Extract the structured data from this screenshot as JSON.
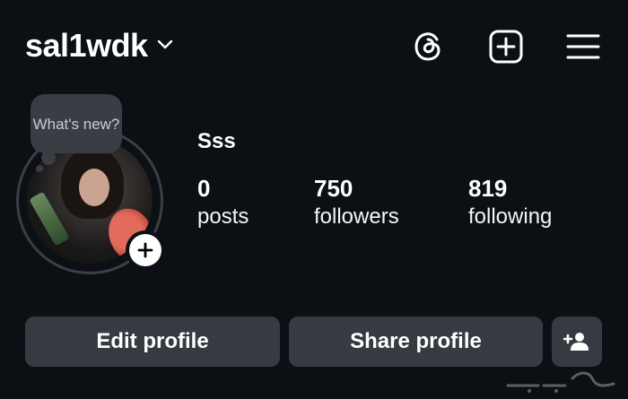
{
  "header": {
    "username": "sal1wdk",
    "icons": {
      "switch_account": "chevron-down-icon",
      "threads": "threads-icon",
      "create": "plus-square-icon",
      "menu": "hamburger-menu-icon"
    }
  },
  "profile": {
    "note_text": "What's new?",
    "display_name": "Sss",
    "stats": [
      {
        "value": "0",
        "label": "posts"
      },
      {
        "value": "750",
        "label": "followers"
      },
      {
        "value": "819",
        "label": "following"
      }
    ]
  },
  "actions": {
    "edit_profile": "Edit profile",
    "share_profile": "Share profile",
    "discover_people_icon": "add-person-icon"
  },
  "colors": {
    "background": "#0c1014",
    "button": "#363a41",
    "note_bubble": "#3a3d44"
  }
}
